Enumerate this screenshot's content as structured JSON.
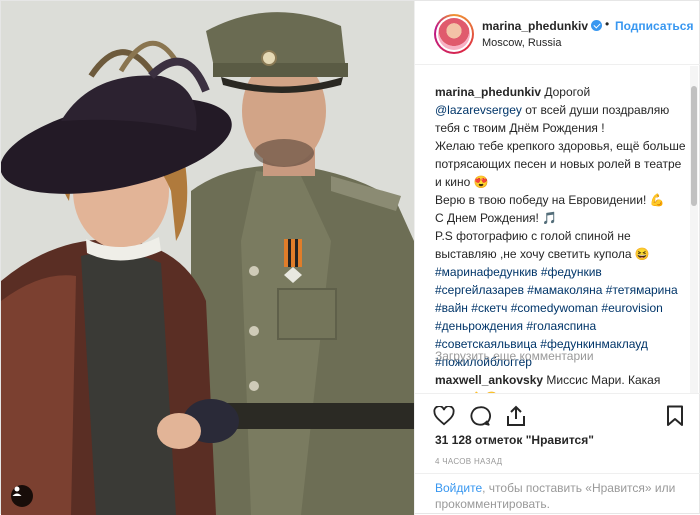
{
  "header": {
    "username": "marina_phedunkiv",
    "dot": "•",
    "follow_label": "Подписаться",
    "location": "Moscow, Russia"
  },
  "caption": {
    "username": "marina_phedunkiv",
    "line1": "Дорогой",
    "mention": "@lazarevsergey",
    "line2": " от всей души поздравляю тебя с твоим Днём Рождения !",
    "line3": "Желаю тебе крепкого здоровья, ещё больше потрясающих песен и новых ролей в театре и кино 😍",
    "line4": "Верю в твою победу на Евровидении! 💪",
    "line5": "С Днем Рождения! 🎵",
    "line6": "P.S фотографию с голой спиной не выставляю ,не хочу светить купола 😆",
    "hashtags": [
      "#маринафедункив",
      "#федункив",
      "#сергейлазарев",
      "#мамаколяна",
      "#тетямарина",
      "#вайн",
      "#скетч",
      "#comedywoman",
      "#eurovision",
      "#деньрождения",
      "#голаяспина",
      "#советскаяльвица",
      "#федункинмаклауд",
      "#пожилойблоггер"
    ]
  },
  "load_more": "Загрузить еще комментарии",
  "comment2": {
    "username": "maxwell_ankovsky",
    "text": " Миссис Мари. Какая честь 👌😋"
  },
  "likes": "31 128 отметок \"Нравится\"",
  "time": "4 часов назад",
  "login": {
    "link": "Войдите",
    "text": ", чтобы поставить «Нравится» или прокомментировать."
  },
  "colors": {
    "accent": "#3897f0",
    "text": "#262626",
    "muted": "#999999"
  }
}
